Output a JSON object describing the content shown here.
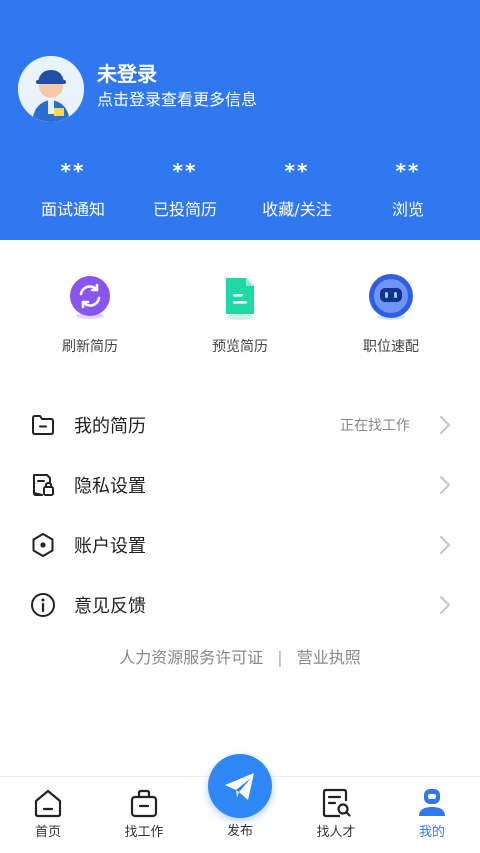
{
  "header": {
    "title": "未登录",
    "subtitle": "点击登录查看更多信息",
    "stats": [
      {
        "value": "**",
        "label": "面试通知"
      },
      {
        "value": "**",
        "label": "已投简历"
      },
      {
        "value": "**",
        "label": "收藏/关注"
      },
      {
        "value": "**",
        "label": "浏览"
      }
    ]
  },
  "quick_actions": [
    {
      "label": "刷新简历",
      "icon": "refresh-icon"
    },
    {
      "label": "预览简历",
      "icon": "document-icon"
    },
    {
      "label": "职位速配",
      "icon": "robot-icon"
    }
  ],
  "menu": [
    {
      "label": "我的简历",
      "extra": "正在找工作",
      "icon": "folder-icon"
    },
    {
      "label": "隐私设置",
      "extra": "",
      "icon": "lock-file-icon"
    },
    {
      "label": "账户设置",
      "extra": "",
      "icon": "hexagon-settings-icon"
    },
    {
      "label": "意见反馈",
      "extra": "",
      "icon": "info-icon"
    }
  ],
  "footer_links": {
    "license": "人力资源服务许可证",
    "separator": "|",
    "business": "营业执照"
  },
  "tabbar": {
    "home": "首页",
    "find_job": "找工作",
    "publish": "发布",
    "find_talent": "找人才",
    "mine": "我的"
  },
  "colors": {
    "primary": "#2f78f0",
    "background": "#ffffff",
    "text": "#222222",
    "muted": "#888888"
  }
}
